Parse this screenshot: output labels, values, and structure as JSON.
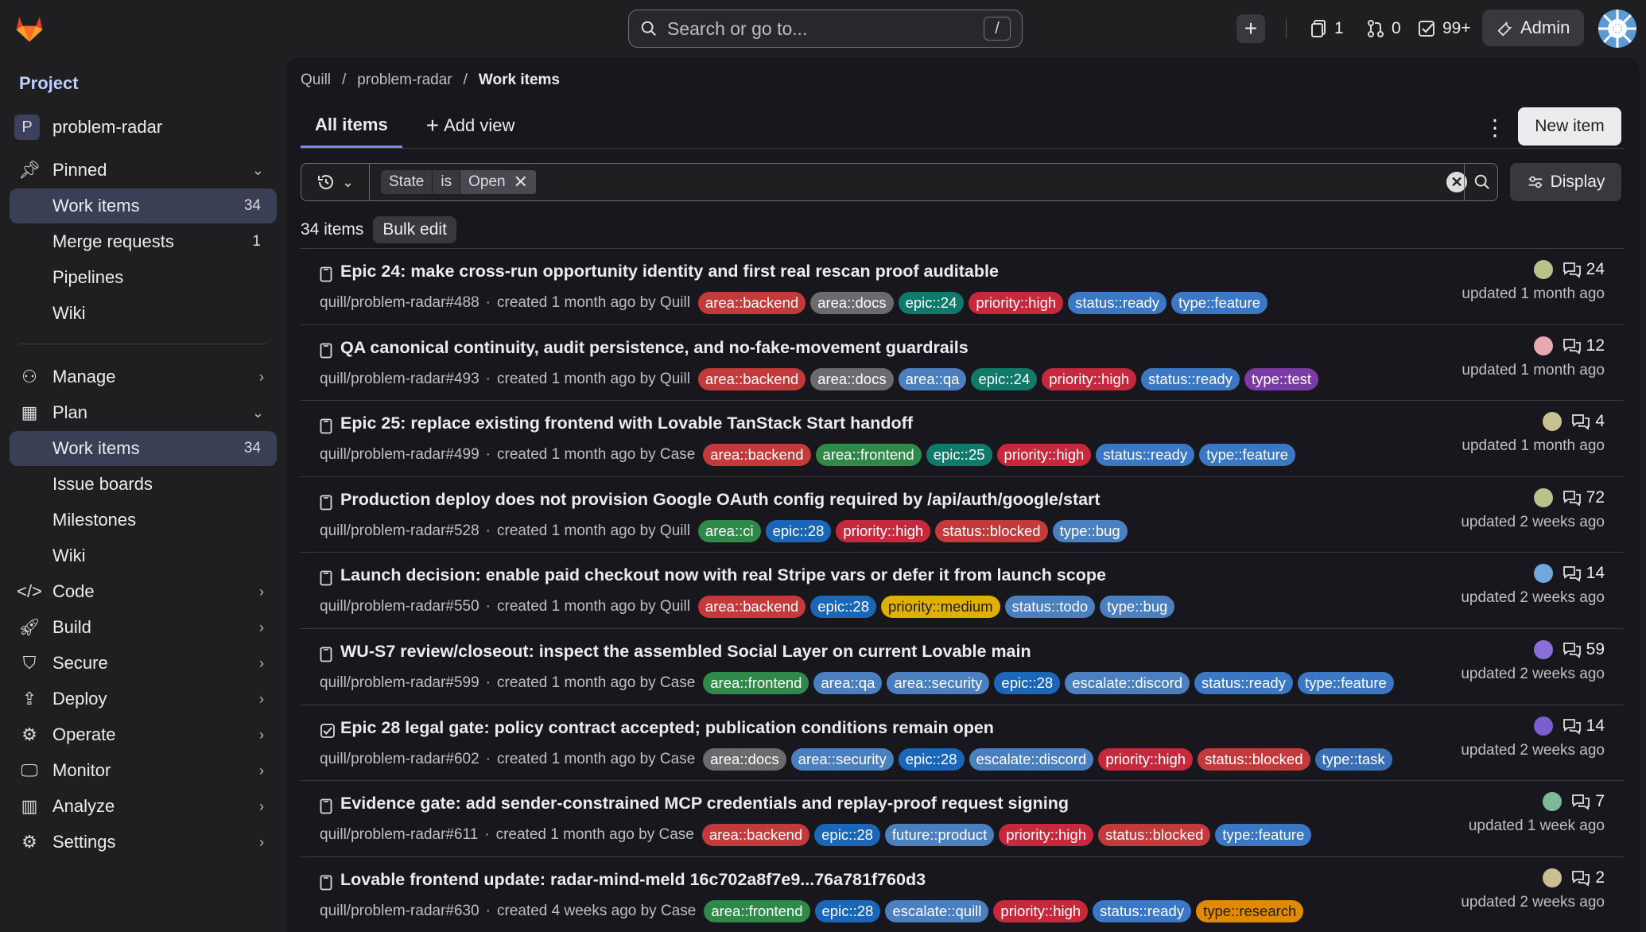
{
  "header": {
    "search_placeholder": "Search or go to...",
    "search_shortcut": "/",
    "issues_count": "1",
    "mr_count": "0",
    "todo_count": "99+",
    "admin_label": "Admin"
  },
  "sidebar": {
    "section_title": "Project",
    "project_initial": "P",
    "project_name": "problem-radar",
    "pinned_label": "Pinned",
    "pinned_items": [
      {
        "label": "Work items",
        "count": "34"
      },
      {
        "label": "Merge requests",
        "count": "1"
      },
      {
        "label": "Pipelines"
      },
      {
        "label": "Wiki"
      }
    ],
    "manage": "Manage",
    "plan": "Plan",
    "plan_items": [
      {
        "label": "Work items",
        "count": "34"
      },
      {
        "label": "Issue boards"
      },
      {
        "label": "Milestones"
      },
      {
        "label": "Wiki"
      }
    ],
    "code": "Code",
    "build": "Build",
    "secure": "Secure",
    "deploy": "Deploy",
    "operate": "Operate",
    "monitor": "Monitor",
    "analyze": "Analyze",
    "settings": "Settings"
  },
  "breadcrumb": [
    "Quill",
    "problem-radar",
    "Work items"
  ],
  "tabs": {
    "all_items": "All items",
    "add_view": "Add view"
  },
  "new_item": "New item",
  "filter": {
    "token_key": "State",
    "token_op": "is",
    "token_val": "Open"
  },
  "display_label": "Display",
  "items_count": "34 items",
  "bulk_edit": "Bulk edit",
  "label_colors": {
    "area::backend": "#c43a3a",
    "area::docs": "#6b6b6e",
    "area::qa": "#4a7fc0",
    "area::frontend": "#2f8a4a",
    "area::ci": "#2f8a4a",
    "area::security": "#4a7fc0",
    "epic::24": "#0e7a6a",
    "epic::25": "#0e7a6a",
    "epic::28": "#1a66b8",
    "priority::high": "#c8283c",
    "priority::medium": "#e0b000",
    "status::ready": "#3a77c4",
    "status::blocked": "#c43a3a",
    "status::todo": "#4a7fc0",
    "type::feature": "#3a77c4",
    "type::test": "#7c3aa6",
    "type::bug": "#4a7fc0",
    "type::task": "#3a6fb8",
    "type::research": "#e08a00",
    "escalate::discord": "#4a7fc0",
    "escalate::quill": "#4a7fc0",
    "future::product": "#4a7fc0"
  },
  "items": [
    {
      "title": "Epic 24: make cross-run opportunity identity and first real rescan proof auditable",
      "ref": "quill/problem-radar#488",
      "created": "created 1 month ago by Quill",
      "labels": [
        "area::backend",
        "area::docs",
        "epic::24",
        "priority::high",
        "status::ready",
        "type::feature"
      ],
      "comments": "24",
      "updated": "updated 1 month ago",
      "avatar": "#b8c28a",
      "icon": "doc-icon"
    },
    {
      "title": "QA canonical continuity, audit persistence, and no-fake-movement guardrails",
      "ref": "quill/problem-radar#493",
      "created": "created 1 month ago by Quill",
      "labels": [
        "area::backend",
        "area::docs",
        "area::qa",
        "epic::24",
        "priority::high",
        "status::ready",
        "type::test"
      ],
      "comments": "12",
      "updated": "updated 1 month ago",
      "avatar": "#e8a8b0",
      "icon": "doc-icon"
    },
    {
      "title": "Epic 25: replace existing frontend with Lovable TanStack Start handoff",
      "ref": "quill/problem-radar#499",
      "created": "created 1 month ago by Case",
      "labels": [
        "area::backend",
        "area::frontend",
        "epic::25",
        "priority::high",
        "status::ready",
        "type::feature"
      ],
      "comments": "4",
      "updated": "updated 1 month ago",
      "avatar": "#c8c090",
      "icon": "doc-icon"
    },
    {
      "title": "Production deploy does not provision Google OAuth config required by /api/auth/google/start",
      "ref": "quill/problem-radar#528",
      "created": "created 1 month ago by Quill",
      "labels": [
        "area::ci",
        "epic::28",
        "priority::high",
        "status::blocked",
        "type::bug"
      ],
      "comments": "72",
      "updated": "updated 2 weeks ago",
      "avatar": "#b8c28a",
      "icon": "doc-icon"
    },
    {
      "title": "Launch decision: enable paid checkout now with real Stripe vars or defer it from launch scope",
      "ref": "quill/problem-radar#550",
      "created": "created 1 month ago by Quill",
      "labels": [
        "area::backend",
        "epic::28",
        "priority::medium",
        "status::todo",
        "type::bug"
      ],
      "comments": "14",
      "updated": "updated 2 weeks ago",
      "avatar": "#6fa8dc",
      "icon": "doc-icon"
    },
    {
      "title": "WU-S7 review/closeout: inspect the assembled Social Layer on current Lovable main",
      "ref": "quill/problem-radar#599",
      "created": "created 1 month ago by Case",
      "labels": [
        "area::frontend",
        "area::qa",
        "area::security",
        "epic::28",
        "escalate::discord",
        "status::ready",
        "type::feature"
      ],
      "comments": "59",
      "updated": "updated 2 weeks ago",
      "avatar": "#8a6fd8",
      "icon": "doc-icon"
    },
    {
      "title": "Epic 28 legal gate: policy contract accepted; publication conditions remain open",
      "ref": "quill/problem-radar#602",
      "created": "created 1 month ago by Case",
      "labels": [
        "area::docs",
        "area::security",
        "epic::28",
        "escalate::discord",
        "priority::high",
        "status::blocked",
        "type::task"
      ],
      "comments": "14",
      "updated": "updated 2 weeks ago",
      "avatar": "#7a5fd0",
      "icon": "task-icon"
    },
    {
      "title": "Evidence gate: add sender-constrained MCP credentials and replay-proof request signing",
      "ref": "quill/problem-radar#611",
      "created": "created 1 month ago by Case",
      "labels": [
        "area::backend",
        "epic::28",
        "future::product",
        "priority::high",
        "status::blocked",
        "type::feature"
      ],
      "comments": "7",
      "updated": "updated 1 week ago",
      "avatar": "#7fb89a",
      "icon": "doc-icon"
    },
    {
      "title": "Lovable frontend update: radar-mind-meld 16c702a8f7e9...76a781f760d3",
      "ref": "quill/problem-radar#630",
      "created": "created 4 weeks ago by Case",
      "labels": [
        "area::frontend",
        "epic::28",
        "escalate::quill",
        "priority::high",
        "status::ready",
        "type::research"
      ],
      "comments": "2",
      "updated": "updated 2 weeks ago",
      "avatar": "#c8c090",
      "icon": "doc-icon"
    }
  ]
}
